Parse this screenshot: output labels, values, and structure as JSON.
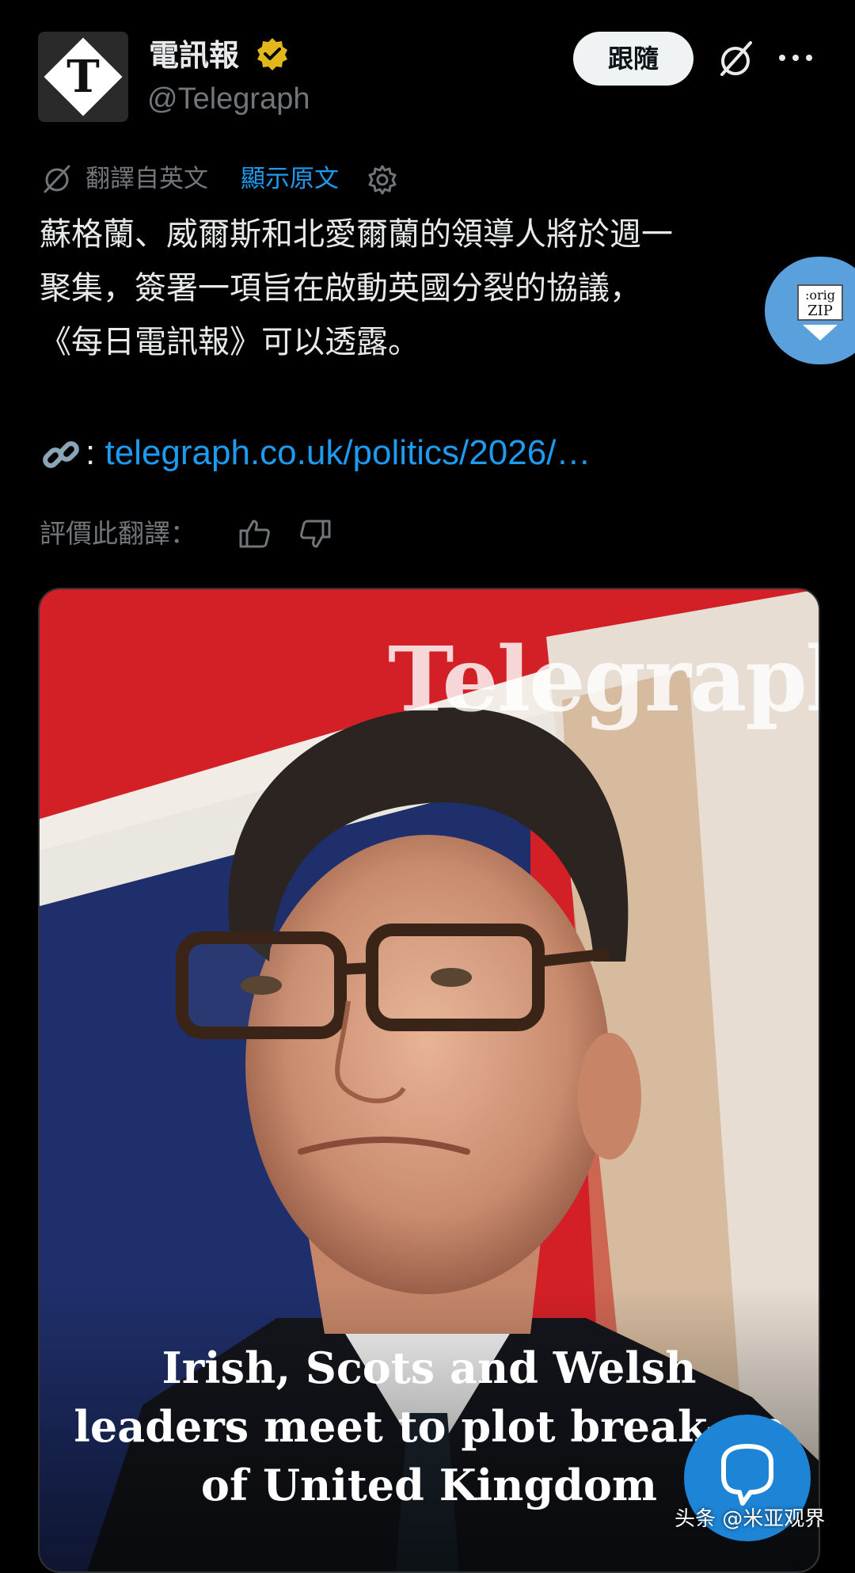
{
  "account": {
    "display_name": "電訊報",
    "handle": "@Telegraph",
    "avatar_letter": "T",
    "verified_color": "#e2b719"
  },
  "header": {
    "follow_label": "跟隨"
  },
  "translation": {
    "label": "翻譯自英文",
    "show_original": "顯示原文"
  },
  "tweet": {
    "lines": [
      "蘇格蘭、威爾斯和北愛爾蘭的領導人將於週一",
      "聚集，簽署一項旨在啟動英國分裂的協議，",
      "《每日電訊報》可以透露。"
    ],
    "link_colon": ":",
    "link_url": "telegraph.co.uk/politics/2026/…"
  },
  "rating": {
    "label": "評價此翻譯："
  },
  "media": {
    "masthead": "Telegraph",
    "headline_lines": [
      "Irish, Scots and Welsh",
      "leaders meet to plot break-up",
      "of United Kingdom"
    ]
  },
  "zip_button": {
    "line1": ":orig",
    "line2": "ZIP"
  },
  "watermark": "头条 @米亚观界",
  "colors": {
    "background": "#000000",
    "text": "#e7e9ea",
    "muted": "#71767b",
    "link": "#1d9bf0",
    "flag_red": "#d32027",
    "flag_blue": "#1f2f6b"
  },
  "icons": {
    "verified": "verified-badge-icon",
    "grok": "grok-icon",
    "more": "more-dots-icon",
    "translate": "translate-icon",
    "settings": "gear-icon",
    "link": "link-icon",
    "thumbs_up": "thumbs-up-icon",
    "thumbs_down": "thumbs-down-icon",
    "reply": "chat-bubble-icon",
    "zip": "zip-download-icon"
  }
}
